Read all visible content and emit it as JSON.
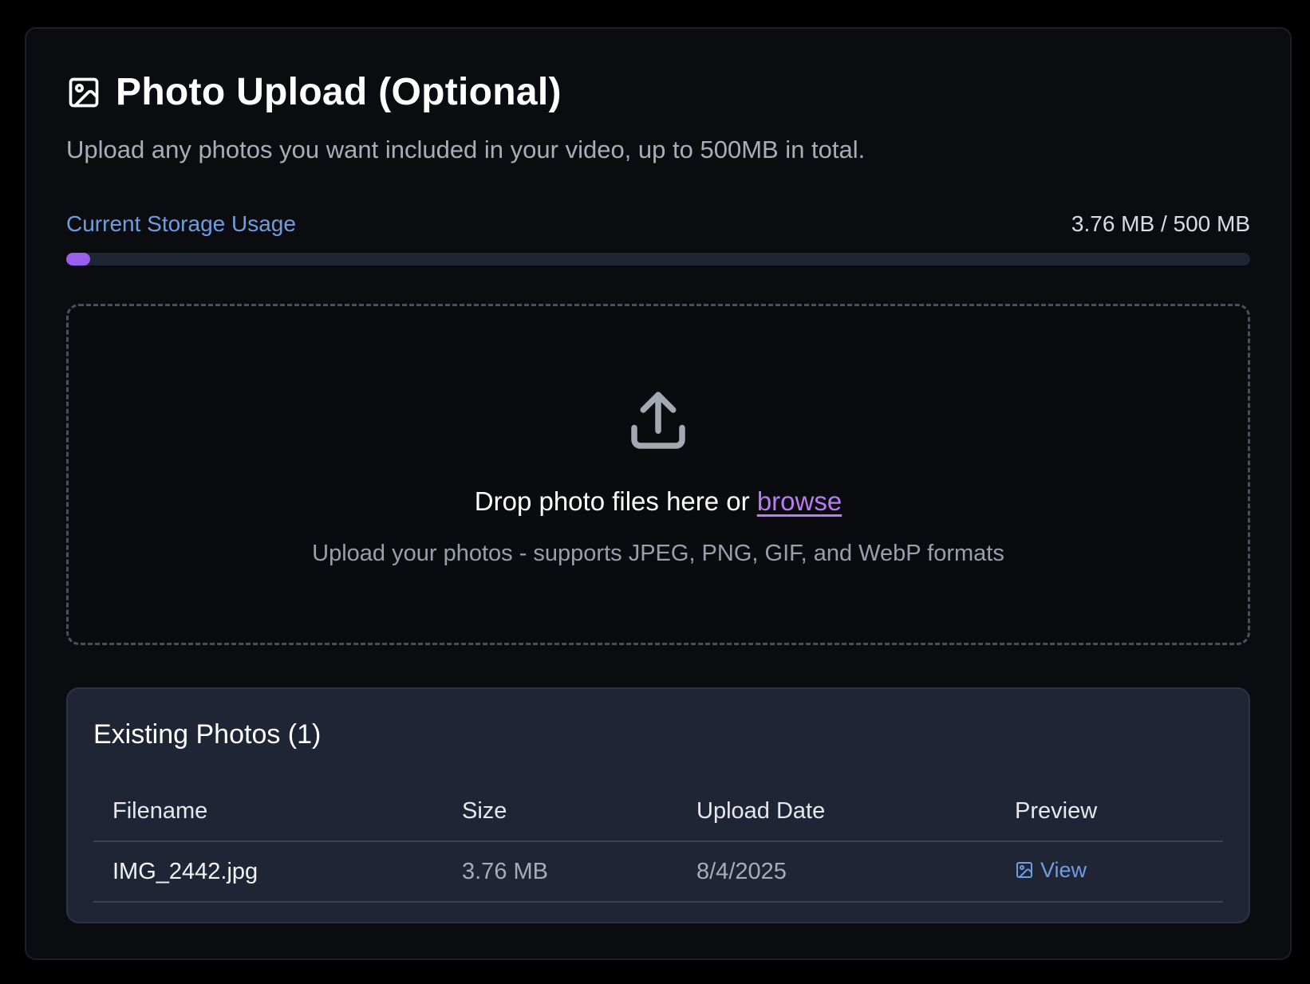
{
  "header": {
    "title_icon": "image-icon",
    "title": "Photo Upload (Optional)",
    "subtitle": "Upload any photos you want included in your video, up to 500MB in total."
  },
  "storage": {
    "label": "Current Storage Usage",
    "usage_text": "3.76 MB / 500 MB",
    "used_mb": 3.76,
    "total_mb": 500,
    "fill_color": "#9b5ff0"
  },
  "dropzone": {
    "icon": "upload-icon",
    "prompt_prefix": "Drop photo files here or ",
    "browse_label": "browse",
    "hint": "Upload your photos - supports JPEG, PNG, GIF, and WebP formats"
  },
  "existing_photos": {
    "title": "Existing Photos (1)",
    "columns": [
      "Filename",
      "Size",
      "Upload Date",
      "Preview"
    ],
    "rows": [
      {
        "filename": "IMG_2442.jpg",
        "size": "3.76 MB",
        "upload_date": "8/4/2025",
        "preview_label": "View",
        "preview_icon": "image-icon"
      }
    ]
  },
  "colors": {
    "accent_blue": "#6f9ee0",
    "accent_purple": "#b97cf2",
    "background": "#0b0c10",
    "panel": "#1f2534"
  }
}
